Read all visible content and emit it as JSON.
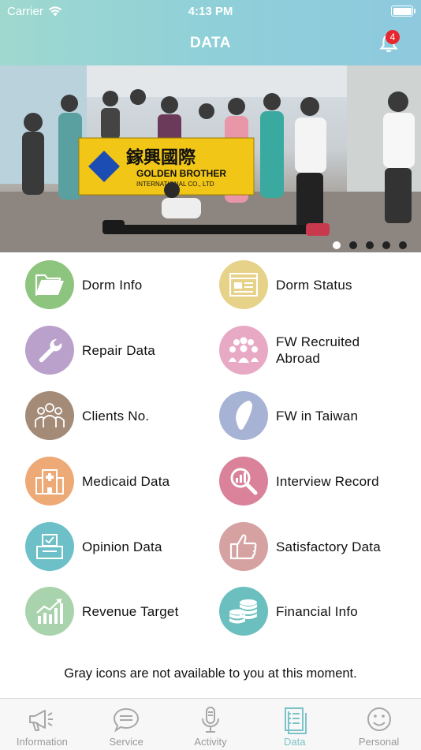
{
  "status": {
    "carrier": "Carrier",
    "time": "4:13 PM"
  },
  "header": {
    "title": "DATA",
    "notification_count": "4"
  },
  "banner": {
    "slides": 5,
    "active_index": 0,
    "flag_text_1": "鎵興國際",
    "flag_text_2": "GOLDEN BROTHER",
    "flag_text_3": "INTERNATIONAL CO., LTD"
  },
  "menu": {
    "dorm_info": "Dorm Info",
    "dorm_status": "Dorm Status",
    "repair_data": "Repair Data",
    "fw_recruited": "FW Recruited Abroad",
    "clients_no": "Clients No.",
    "fw_taiwan": "FW in Taiwan",
    "medicaid": "Medicaid Data",
    "interview": "Interview Record",
    "opinion": "Opinion Data",
    "satisfactory": "Satisfactory Data",
    "revenue": "Revenue Target",
    "financial": "Financial Info"
  },
  "colors": {
    "dorm_info": "#8dc47e",
    "dorm_status": "#e7d28a",
    "repair_data": "#b9a1cc",
    "fw_recruited": "#e8a9c5",
    "clients_no": "#a38b78",
    "fw_taiwan": "#a7b3d5",
    "medicaid": "#eeaa76",
    "interview": "#d9829a",
    "opinion": "#6dc0c8",
    "satisfactory": "#d6a1a1",
    "revenue": "#a9d3ac",
    "financial": "#6cbfbf"
  },
  "note": "Gray icons are not available to you at this moment.",
  "tabs": {
    "information": "Information",
    "service": "Service",
    "activity": "Activity",
    "data": "Data",
    "personal": "Personal"
  }
}
